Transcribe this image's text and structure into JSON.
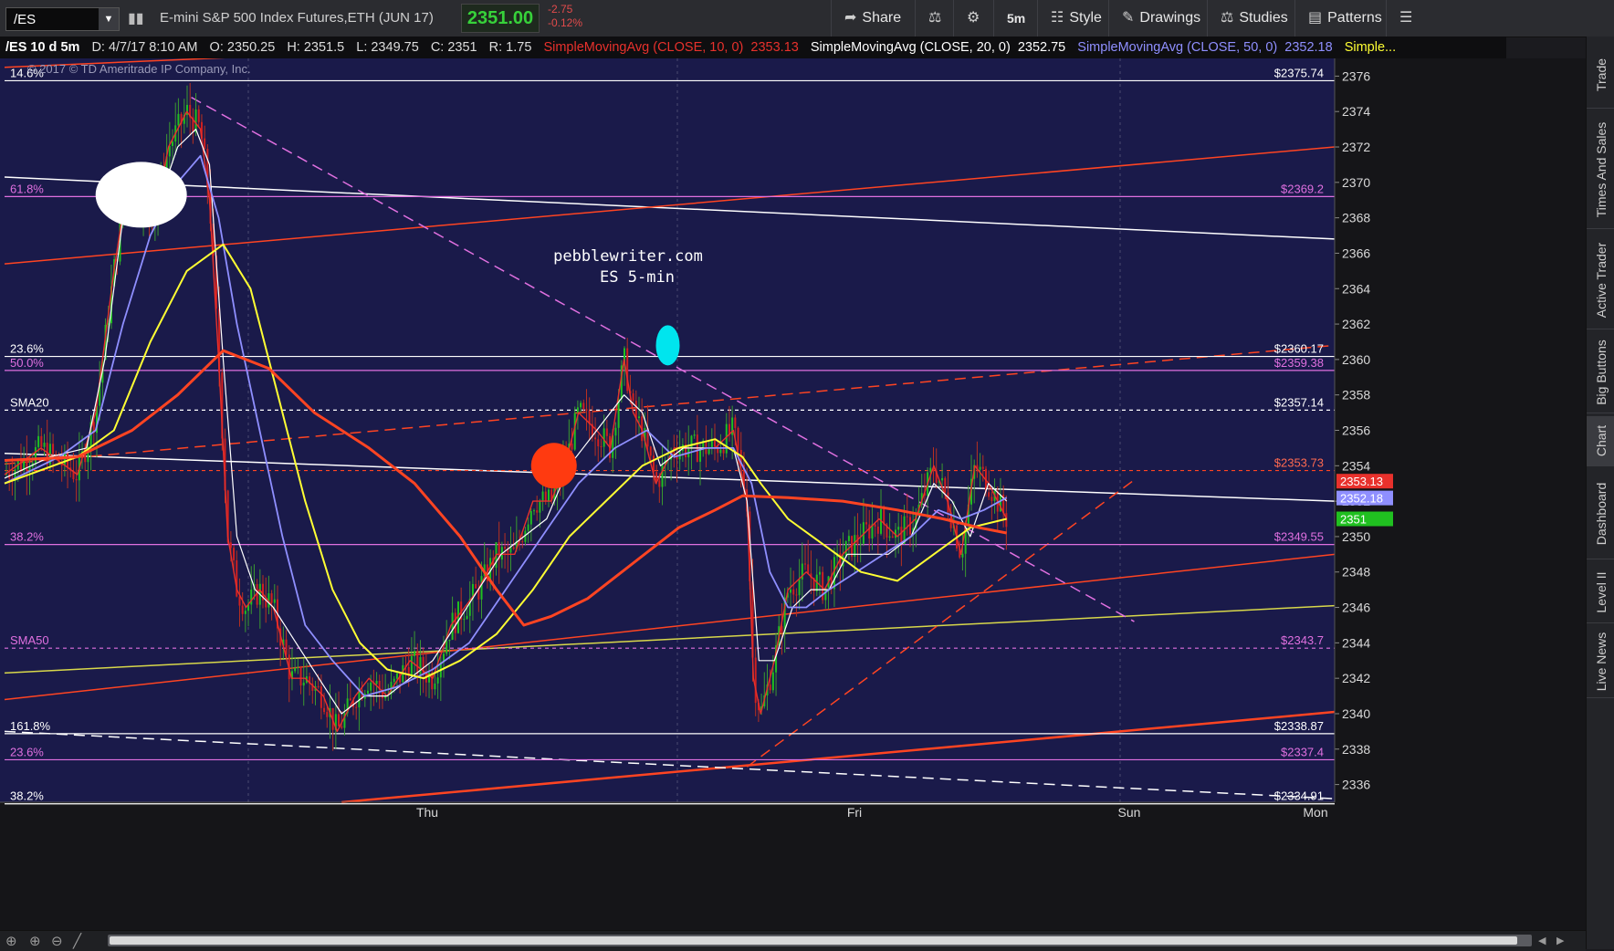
{
  "toolbar": {
    "symbol": "/ES",
    "instrument": "E-mini S&P 500 Index Futures,ETH (JUN 17)",
    "last": "2351.00",
    "change": "-2.75",
    "change_pct": "-0.12%",
    "buttons": {
      "share": "Share",
      "timeframe": "5m",
      "style": "Style",
      "drawings": "Drawings",
      "studies": "Studies",
      "patterns": "Patterns"
    }
  },
  "header": {
    "symbol_period": "/ES 10 d 5m",
    "date": "D: 4/7/17 8:10 AM",
    "open": "O: 2350.25",
    "high": "H: 2351.5",
    "low": "L: 2349.75",
    "close": "C: 2351",
    "range": "R: 1.75",
    "sma10_label": "SimpleMovingAvg (CLOSE, 10, 0)",
    "sma10_value": "2353.13",
    "sma20_label": "SimpleMovingAvg (CLOSE, 20, 0)",
    "sma20_value": "2352.75",
    "sma50_label": "SimpleMovingAvg (CLOSE, 50, 0)",
    "sma50_value": "2352.18",
    "more": "Simple..."
  },
  "copyright": "© 2017 © TD Ameritrade IP Company, Inc.",
  "side_tabs": [
    "Trade",
    "Times And Sales",
    "Active Trader",
    "Big Buttons",
    "Chart",
    "Dashboard",
    "Level II",
    "Live News"
  ],
  "colors": {
    "background": "#1a1a4a",
    "sma10": "#e8312c",
    "sma20": "#ffffff",
    "sma50": "#8f8fff",
    "sma_yellow": "#ffff33",
    "sma_red_slow": "#ff4422",
    "fib": "#e070e0",
    "up_candle": "#20c020",
    "down_candle": "#d02020"
  },
  "chart_data": {
    "type": "line",
    "title": "pebblewriter.com",
    "subtitle": "ES 5-min",
    "ylim": [
      2335,
      2377
    ],
    "y_ticks": [
      2336,
      2338,
      2340,
      2342,
      2344,
      2346,
      2348,
      2350,
      2352,
      2354,
      2356,
      2358,
      2360,
      2362,
      2364,
      2366,
      2368,
      2370,
      2372,
      2374,
      2376
    ],
    "x_ticks": [
      "Thu",
      "Fri",
      "Sun",
      "Mon"
    ],
    "horizontal_levels": [
      {
        "left_label": "14.6%",
        "right_label": "$2375.74",
        "value": 2375.74,
        "color": "#ffffff",
        "style": "solid"
      },
      {
        "left_label": "61.8%",
        "right_label": "$2369.2",
        "value": 2369.2,
        "color": "#e070e0",
        "style": "solid"
      },
      {
        "left_label": "23.6%",
        "right_label": "$2360.17",
        "value": 2360.17,
        "color": "#ffffff",
        "style": "solid"
      },
      {
        "left_label": "50.0%",
        "right_label": "$2359.38",
        "value": 2359.38,
        "color": "#e070e0",
        "style": "solid"
      },
      {
        "left_label": "SMA20",
        "right_label": "$2357.14",
        "value": 2357.14,
        "color": "#ffffff",
        "style": "dotted"
      },
      {
        "left_label": "",
        "right_label": "$2353.73",
        "value": 2353.73,
        "color": "#ff4422",
        "style": "dotted"
      },
      {
        "left_label": "38.2%",
        "right_label": "$2349.55",
        "value": 2349.55,
        "color": "#e070e0",
        "style": "solid"
      },
      {
        "left_label": "SMA50",
        "right_label": "$2343.7",
        "value": 2343.7,
        "color": "#e070e0",
        "style": "dotted"
      },
      {
        "left_label": "161.8%",
        "right_label": "$2338.87",
        "value": 2338.87,
        "color": "#ffffff",
        "style": "solid"
      },
      {
        "left_label": "23.6%",
        "right_label": "$2337.4",
        "value": 2337.4,
        "color": "#e070e0",
        "style": "solid"
      },
      {
        "left_label": "38.2%",
        "right_label": "$2334.91",
        "value": 2334.91,
        "color": "#ffffff",
        "style": "solid"
      }
    ],
    "price_tags": [
      {
        "label": "2353.13",
        "value": 2353.13,
        "color": "#e8312c"
      },
      {
        "label": "2352.18",
        "value": 2352.18,
        "color": "#8f8fff"
      },
      {
        "label": "2351",
        "value": 2351.0,
        "color": "#20c020"
      }
    ],
    "x_domain": [
      0,
      1460
    ],
    "series": [
      {
        "color": "#e8312c",
        "points": [
          [
            0,
            2353.5
          ],
          [
            40,
            2355
          ],
          [
            80,
            2353.5
          ],
          [
            100,
            2357
          ],
          [
            120,
            2365
          ],
          [
            135,
            2370
          ],
          [
            150,
            2369
          ],
          [
            165,
            2368
          ],
          [
            180,
            2372
          ],
          [
            200,
            2374
          ],
          [
            215,
            2373
          ],
          [
            225,
            2369
          ],
          [
            235,
            2360
          ],
          [
            245,
            2350
          ],
          [
            255,
            2347
          ],
          [
            265,
            2346
          ],
          [
            280,
            2347
          ],
          [
            295,
            2346
          ],
          [
            315,
            2342
          ],
          [
            330,
            2342
          ],
          [
            350,
            2341
          ],
          [
            365,
            2339
          ],
          [
            385,
            2341
          ],
          [
            400,
            2342
          ],
          [
            420,
            2341
          ],
          [
            445,
            2343
          ],
          [
            470,
            2342
          ],
          [
            490,
            2345
          ],
          [
            520,
            2347
          ],
          [
            540,
            2349
          ],
          [
            560,
            2349
          ],
          [
            580,
            2352
          ],
          [
            600,
            2352
          ],
          [
            615,
            2354
          ],
          [
            630,
            2357
          ],
          [
            650,
            2356
          ],
          [
            665,
            2355
          ],
          [
            680,
            2360
          ],
          [
            690,
            2357
          ],
          [
            700,
            2356
          ],
          [
            715,
            2353
          ],
          [
            735,
            2355
          ],
          [
            760,
            2355
          ],
          [
            780,
            2355
          ],
          [
            800,
            2356
          ],
          [
            815,
            2352
          ],
          [
            822,
            2342
          ],
          [
            830,
            2340
          ],
          [
            845,
            2343
          ],
          [
            860,
            2347
          ],
          [
            880,
            2348
          ],
          [
            900,
            2347
          ],
          [
            920,
            2349
          ],
          [
            940,
            2350
          ],
          [
            960,
            2351
          ],
          [
            980,
            2350
          ],
          [
            1000,
            2351
          ],
          [
            1020,
            2354
          ],
          [
            1035,
            2352
          ],
          [
            1050,
            2349
          ],
          [
            1065,
            2354
          ],
          [
            1080,
            2353
          ],
          [
            1090,
            2352
          ],
          [
            1100,
            2351
          ]
        ]
      },
      {
        "color": "#ffffff",
        "points": [
          [
            0,
            2353.3
          ],
          [
            50,
            2354.5
          ],
          [
            90,
            2355
          ],
          [
            110,
            2360
          ],
          [
            130,
            2368
          ],
          [
            150,
            2369
          ],
          [
            170,
            2369
          ],
          [
            190,
            2372
          ],
          [
            210,
            2373
          ],
          [
            225,
            2371
          ],
          [
            240,
            2360
          ],
          [
            255,
            2350
          ],
          [
            275,
            2347
          ],
          [
            295,
            2346
          ],
          [
            320,
            2344
          ],
          [
            345,
            2342
          ],
          [
            370,
            2340
          ],
          [
            395,
            2341
          ],
          [
            420,
            2341
          ],
          [
            445,
            2342
          ],
          [
            470,
            2343
          ],
          [
            495,
            2345
          ],
          [
            520,
            2347
          ],
          [
            545,
            2349
          ],
          [
            570,
            2350
          ],
          [
            595,
            2351
          ],
          [
            620,
            2354
          ],
          [
            650,
            2356
          ],
          [
            680,
            2358
          ],
          [
            700,
            2357
          ],
          [
            720,
            2354
          ],
          [
            745,
            2355
          ],
          [
            775,
            2355
          ],
          [
            800,
            2355
          ],
          [
            815,
            2352
          ],
          [
            828,
            2343
          ],
          [
            845,
            2343
          ],
          [
            865,
            2346
          ],
          [
            885,
            2347
          ],
          [
            905,
            2347
          ],
          [
            925,
            2349
          ],
          [
            945,
            2349
          ],
          [
            970,
            2349
          ],
          [
            995,
            2350
          ],
          [
            1020,
            2353
          ],
          [
            1040,
            2352
          ],
          [
            1060,
            2350
          ],
          [
            1080,
            2353
          ],
          [
            1100,
            2352
          ]
        ]
      },
      {
        "color": "#8f8fff",
        "points": [
          [
            0,
            2353
          ],
          [
            60,
            2354.5
          ],
          [
            100,
            2356
          ],
          [
            130,
            2362
          ],
          [
            160,
            2367
          ],
          [
            190,
            2370
          ],
          [
            215,
            2371.5
          ],
          [
            235,
            2368
          ],
          [
            255,
            2362
          ],
          [
            280,
            2356
          ],
          [
            305,
            2350
          ],
          [
            330,
            2345
          ],
          [
            360,
            2343
          ],
          [
            395,
            2341
          ],
          [
            430,
            2341.5
          ],
          [
            470,
            2342.5
          ],
          [
            510,
            2344
          ],
          [
            550,
            2347
          ],
          [
            590,
            2350
          ],
          [
            630,
            2353
          ],
          [
            670,
            2355
          ],
          [
            705,
            2356
          ],
          [
            735,
            2354.5
          ],
          [
            770,
            2355
          ],
          [
            800,
            2355
          ],
          [
            820,
            2353
          ],
          [
            840,
            2348
          ],
          [
            860,
            2346
          ],
          [
            880,
            2346
          ],
          [
            905,
            2347
          ],
          [
            935,
            2348
          ],
          [
            965,
            2349
          ],
          [
            995,
            2350
          ],
          [
            1025,
            2351.5
          ],
          [
            1050,
            2351
          ],
          [
            1075,
            2351.5
          ],
          [
            1100,
            2352.2
          ]
        ]
      },
      {
        "color": "#ffff33",
        "points": [
          [
            0,
            2353
          ],
          [
            80,
            2354.5
          ],
          [
            120,
            2356
          ],
          [
            160,
            2361
          ],
          [
            200,
            2365
          ],
          [
            240,
            2366.5
          ],
          [
            270,
            2364
          ],
          [
            300,
            2358
          ],
          [
            330,
            2352
          ],
          [
            360,
            2347
          ],
          [
            390,
            2344
          ],
          [
            420,
            2342.5
          ],
          [
            460,
            2342
          ],
          [
            500,
            2343
          ],
          [
            540,
            2344.5
          ],
          [
            580,
            2347
          ],
          [
            620,
            2350
          ],
          [
            660,
            2352
          ],
          [
            700,
            2354
          ],
          [
            740,
            2355
          ],
          [
            780,
            2355.5
          ],
          [
            810,
            2354.5
          ],
          [
            830,
            2353
          ],
          [
            860,
            2351
          ],
          [
            900,
            2349.5
          ],
          [
            940,
            2348
          ],
          [
            980,
            2347.5
          ],
          [
            1020,
            2349
          ],
          [
            1060,
            2350.5
          ],
          [
            1100,
            2351
          ]
        ]
      },
      {
        "color": "#ff4422",
        "points": [
          [
            0,
            2354.3
          ],
          [
            80,
            2354.5
          ],
          [
            140,
            2356
          ],
          [
            190,
            2358
          ],
          [
            240,
            2360.5
          ],
          [
            290,
            2359.5
          ],
          [
            340,
            2357
          ],
          [
            400,
            2355
          ],
          [
            450,
            2353
          ],
          [
            500,
            2350
          ],
          [
            540,
            2347
          ],
          [
            570,
            2345
          ],
          [
            600,
            2345.5
          ],
          [
            640,
            2346.5
          ],
          [
            690,
            2348.5
          ],
          [
            740,
            2350.5
          ],
          [
            780,
            2351.5
          ],
          [
            810,
            2352.3
          ],
          [
            860,
            2352.2
          ],
          [
            920,
            2352
          ],
          [
            980,
            2351.5
          ],
          [
            1030,
            2351
          ],
          [
            1070,
            2350.5
          ],
          [
            1100,
            2350.2
          ]
        ]
      }
    ],
    "trendlines": [
      {
        "from": [
          0,
          2370.3
        ],
        "to": [
          1460,
          2366.8
        ],
        "color": "#ffffff",
        "style": "solid"
      },
      {
        "from": [
          0,
          2365.4
        ],
        "to": [
          1460,
          2372
        ],
        "color": "#ff4422",
        "style": "solid"
      },
      {
        "from": [
          0,
          2354.7
        ],
        "to": [
          1460,
          2352
        ],
        "color": "#ffffff",
        "style": "solid"
      },
      {
        "from": [
          0,
          2354.1
        ],
        "to": [
          1460,
          2360.8
        ],
        "color": "#ff4422",
        "style": "dashed"
      },
      {
        "from": [
          0,
          2342.3
        ],
        "to": [
          1460,
          2346.1
        ],
        "color": "#d8d84a",
        "style": "solid"
      },
      {
        "from": [
          0,
          2340.8
        ],
        "to": [
          1460,
          2349
        ],
        "color": "#ff4422",
        "style": "solid"
      },
      {
        "from": [
          370,
          2335
        ],
        "to": [
          1460,
          2340.1
        ],
        "color": "#ff4422",
        "style": "solid"
      },
      {
        "from": [
          0,
          2339
        ],
        "to": [
          1460,
          2335.2
        ],
        "color": "#ffffff",
        "style": "dashed"
      },
      {
        "from": [
          205,
          2374.8
        ],
        "to": [
          1240,
          2345.2
        ],
        "color": "#e070e0",
        "style": "dashed"
      },
      {
        "from": [
          815,
          2337
        ],
        "to": [
          1240,
          2353.2
        ],
        "color": "#ff4422",
        "style": "dashed"
      },
      {
        "from": [
          0,
          2376.5
        ],
        "to": [
          360,
          2377.3
        ],
        "color": "#ff4422",
        "style": "solid"
      }
    ],
    "markers": [
      {
        "shape": "ellipse",
        "cx": 150,
        "cy": 2369.3,
        "color": "#ffffff"
      },
      {
        "shape": "ellipse",
        "cx": 728,
        "cy": 2360.8,
        "color": "#00e5ee"
      },
      {
        "shape": "circle",
        "cx": 603,
        "cy": 2354.0,
        "color": "#ff3a10"
      }
    ]
  }
}
